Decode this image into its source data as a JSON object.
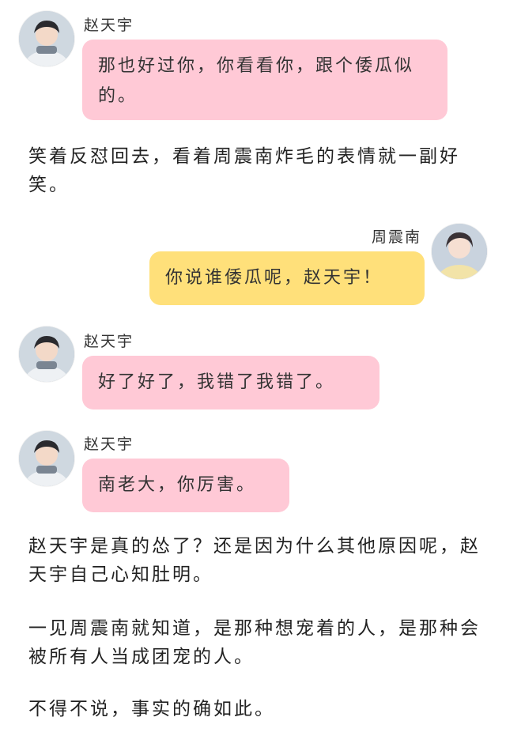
{
  "messages": [
    {
      "sender": "赵天宇",
      "text": "那也好过你，你看看你，跟个倭瓜似的。",
      "bubble_color": "#ffc9d6"
    },
    {
      "sender": "周震南",
      "text": "你说谁倭瓜呢，赵天宇！",
      "bubble_color": "#ffe07a"
    },
    {
      "sender": "赵天宇",
      "text": "好了好了，我错了我错了。",
      "bubble_color": "#ffc9d6"
    },
    {
      "sender": "赵天宇",
      "text": "南老大，你厉害。",
      "bubble_color": "#ffc9d6"
    }
  ],
  "narration": [
    "笑着反怼回去，看着周震南炸毛的表情就一副好笑。",
    "赵天宇是真的怂了？还是因为什么其他原因呢，赵天宇自己心知肚明。",
    "一见周震南就知道，是那种想宠着的人，是那种会被所有人当成团宠的人。",
    "不得不说，事实的确如此。"
  ]
}
